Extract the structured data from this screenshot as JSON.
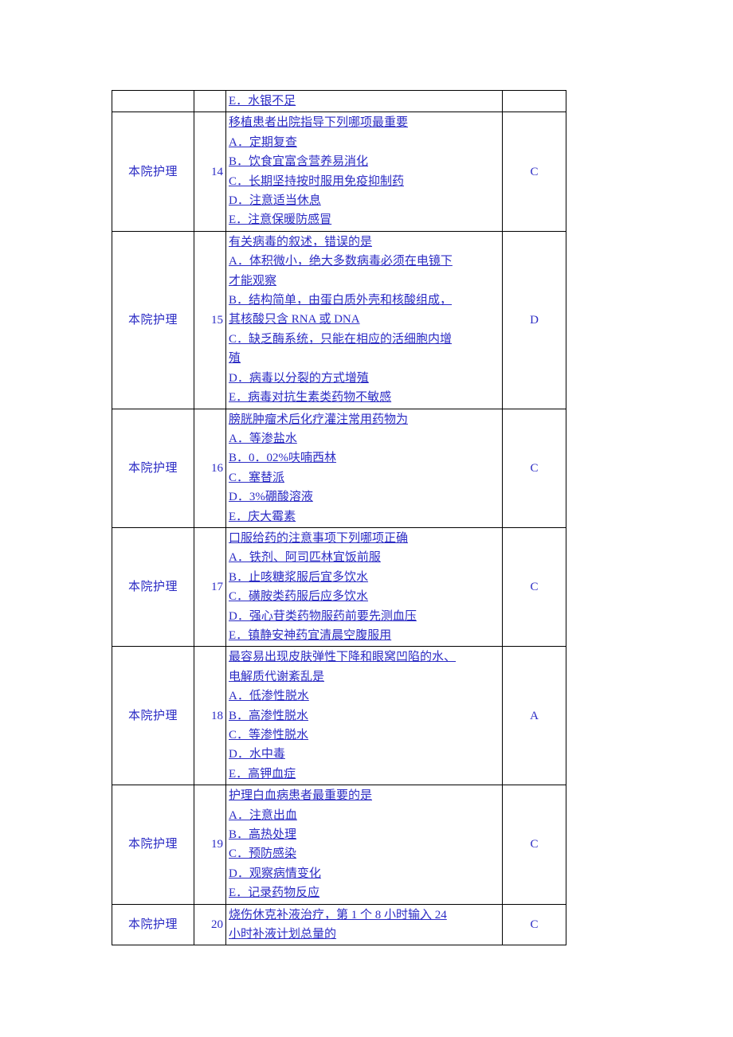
{
  "document": {
    "page_background": "#ffffff",
    "link_text_color": "#2b2bc4",
    "border_color": "#000000"
  },
  "table": {
    "columns": [
      "department",
      "number",
      "content",
      "answer"
    ],
    "rows": [
      {
        "department": "",
        "number": "",
        "lines": [
          "E．水银不足 "
        ],
        "answer": ""
      },
      {
        "department": "本院护理",
        "number": "14",
        "lines": [
          "移植患者出院指导下列哪项最重要 ",
          "A．定期复查 ",
          "B．饮食宜富含营养易消化 ",
          "C．长期坚持按时服用免疫抑制药 ",
          "D．注意适当休息 ",
          "E．注意保暖防感冒"
        ],
        "answer": "C"
      },
      {
        "department": "本院护理",
        "number": "15",
        "lines": [
          "有关病毒的叙述，错误的是",
          "A．体积微小，绝大多数病毒必须在电镜下",
          "才能观察 ",
          "B．结构简单，由蛋白质外壳和核酸组成，",
          "其核酸只含 RNA 或 DNA ",
          "C．缺乏酶系统，只能在相应的活细胞内增",
          "殖",
          "D．病毒以分裂的方式增殖 ",
          "E．病毒对抗生素类药物不敏感"
        ],
        "answer": "D"
      },
      {
        "department": "本院护理",
        "number": "16",
        "lines": [
          "膀胱肿瘤术后化疗灌注常用药物为 ",
          "A．等渗盐水 ",
          "B．0．02%呋喃西林 ",
          "C．塞替派 ",
          "D．3%硼酸溶液 ",
          "E．庆大霉素"
        ],
        "answer": "C"
      },
      {
        "department": "本院护理",
        "number": "17",
        "lines": [
          "口服给药的注意事项下列哪项正确 ",
          "A．铁剂、阿司匹林宜饭前服 ",
          "B．止咳糖浆服后宜多饮水",
          "C．磺胺类药服后应多饮水 ",
          "D．强心苷类药物服药前要先测血压 ",
          "E．镇静安神药宜清晨空腹服用 "
        ],
        "answer": "C"
      },
      {
        "department": "本院护理",
        "number": "18",
        "lines": [
          "最容易出现皮肤弹性下降和眼窝凹陷的水、",
          "电解质代谢紊乱是",
          "A．低渗性脱水 ",
          "B．高渗性脱水 ",
          "C．等渗性脱水",
          "D．水中毒 ",
          "E．高钾血症"
        ],
        "answer": "A"
      },
      {
        "department": "本院护理",
        "number": "19",
        "lines": [
          "护理白血病患者最重要的是",
          "A．注意出血 ",
          "B．高热处理 ",
          "C．预防感染",
          "D．观察病情变化 ",
          "E．记录药物反应"
        ],
        "answer": "C"
      },
      {
        "department": "本院护理",
        "number": "20",
        "lines": [
          "烧伤休克补液治疗，第 1 个 8 小时输入 24",
          "小时补液计划总量的"
        ],
        "answer": "C"
      }
    ]
  }
}
